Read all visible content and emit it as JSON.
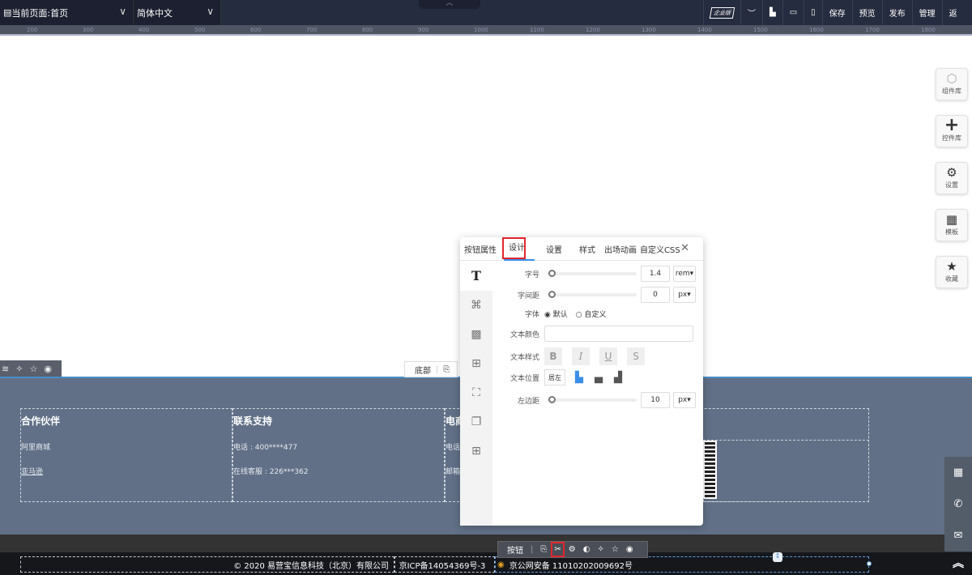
{
  "topbar": {
    "page_select": "当前页面:首页",
    "lang_select": "简体中文",
    "edition_badge": "企业版",
    "actions": [
      "保存",
      "预览",
      "发布",
      "管理",
      "返"
    ]
  },
  "ruler": {
    "labels": [
      "200",
      "300",
      "400",
      "500",
      "600",
      "700",
      "800",
      "900",
      "1000",
      "1100",
      "1200",
      "1300",
      "1400",
      "1500",
      "1600",
      "1700",
      "1800"
    ]
  },
  "right_tools": [
    {
      "label": "组件库",
      "icon": "cube-icon"
    },
    {
      "label": "控件库",
      "icon": "plus-icon"
    },
    {
      "label": "设置",
      "icon": "gears-icon"
    },
    {
      "label": "模板",
      "icon": "grid-icon"
    },
    {
      "label": "收藏",
      "icon": "star-icon"
    }
  ],
  "section_label": "底部",
  "footer": {
    "columns": [
      {
        "title": "合作伙伴",
        "items": [
          "阿里商城",
          "亚马逊"
        ]
      },
      {
        "title": "联系支持",
        "items": [
          "电话 : 400****477",
          "在线客服 : 226***362"
        ]
      },
      {
        "title": "电商",
        "items": [
          "电话",
          "邮箱"
        ]
      }
    ],
    "copyright": "© 2020 易营宝信息科技（北京）有限公司",
    "icp": "京ICP备14054369号-3",
    "police": "京公网安备 11010202009692号"
  },
  "button_toolbar": {
    "label": "按钮"
  },
  "panel": {
    "tabs": [
      "按钮属性",
      "设计",
      "设置",
      "样式",
      "出场动画",
      "自定义CSS"
    ],
    "active_tab": "设计",
    "font_size": {
      "label": "字号",
      "value": "1.4",
      "unit": "rem"
    },
    "letter_spacing": {
      "label": "字间距",
      "value": "0",
      "unit": "px"
    },
    "font": {
      "label": "字体",
      "options": [
        "默认",
        "自定义"
      ],
      "selected": "默认"
    },
    "text_color": {
      "label": "文本颜色",
      "value": ""
    },
    "text_style": {
      "label": "文本样式",
      "buttons": [
        "B",
        "I",
        "U",
        "S"
      ]
    },
    "text_position": {
      "label": "文本位置",
      "value": "居左"
    },
    "left_margin": {
      "label": "左边距",
      "value": "10",
      "unit": "px"
    }
  }
}
